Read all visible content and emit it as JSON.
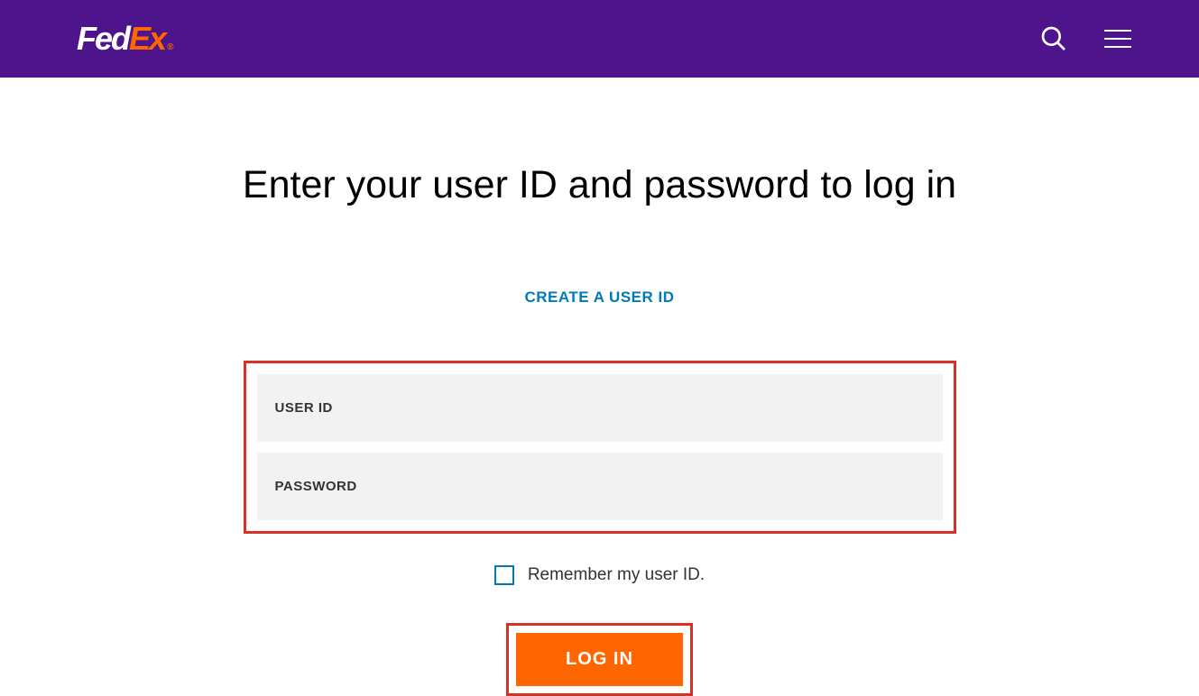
{
  "header": {
    "logo": {
      "part1": "Fed",
      "part2": "Ex",
      "trademark": "®"
    }
  },
  "main": {
    "title": "Enter your user ID and password to log in",
    "create_link": "CREATE A USER ID",
    "form": {
      "user_id_placeholder": "USER ID",
      "user_id_value": "",
      "password_placeholder": "PASSWORD",
      "password_value": ""
    },
    "remember": {
      "label": "Remember my user ID.",
      "checked": false
    },
    "login_button": "LOG IN"
  }
}
